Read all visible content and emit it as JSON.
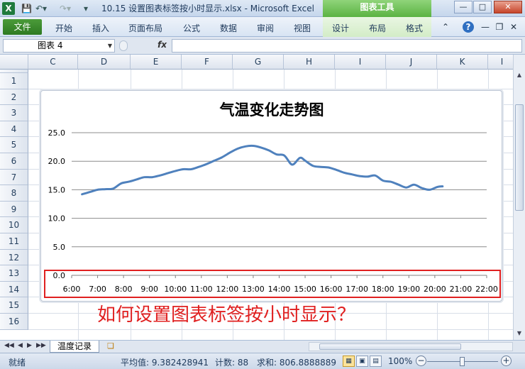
{
  "titlebar": {
    "app_icon": "X",
    "title": "10.15 设置图表标签按小时显示.xlsx  -  Microsoft Excel",
    "chart_tools": "图表工具",
    "icons": [
      "save-icon",
      "undo-icon",
      "redo-icon",
      "customize-icon"
    ]
  },
  "ribbon": {
    "file": "文件",
    "tabs": [
      "开始",
      "插入",
      "页面布局",
      "公式",
      "数据",
      "审阅",
      "视图"
    ],
    "context_tabs": [
      "设计",
      "布局",
      "格式"
    ]
  },
  "formula_bar": {
    "name_box": "图表 4",
    "fx": "fx",
    "value": ""
  },
  "grid": {
    "columns": [
      "C",
      "D",
      "E",
      "F",
      "G",
      "H",
      "I",
      "J",
      "K",
      "I"
    ],
    "rows": [
      "1",
      "2",
      "3",
      "4",
      "5",
      "6",
      "7",
      "8",
      "9",
      "10",
      "11",
      "12",
      "13",
      "14",
      "15",
      "16"
    ]
  },
  "chart_data": {
    "type": "line",
    "title": "气温变化走势图",
    "xlabel": "",
    "ylabel": "",
    "ylim": [
      0,
      25
    ],
    "yticks": [
      "0.0",
      "5.0",
      "10.0",
      "15.0",
      "20.0",
      "25.0"
    ],
    "xlim": [
      6,
      22
    ],
    "xticks": [
      "6:00",
      "7:00",
      "8:00",
      "9:00",
      "10:00",
      "11:00",
      "12:00",
      "13:00",
      "14:00",
      "15:00",
      "16:00",
      "17:00",
      "18:00",
      "19:00",
      "20:00",
      "21:00",
      "22:00"
    ],
    "grid": true,
    "legend": "none",
    "color": "#4f81bd",
    "x": [
      6.4,
      6.7,
      7.0,
      7.3,
      7.6,
      7.9,
      8.2,
      8.5,
      8.8,
      9.1,
      9.4,
      9.7,
      10.0,
      10.3,
      10.6,
      10.9,
      11.2,
      11.5,
      11.8,
      12.1,
      12.4,
      12.7,
      13.0,
      13.3,
      13.6,
      13.9,
      14.2,
      14.5,
      14.8,
      15.0,
      15.3,
      15.6,
      15.9,
      16.2,
      16.5,
      16.8,
      17.1,
      17.4,
      17.7,
      18.0,
      18.3,
      18.6,
      18.9,
      19.2,
      19.5,
      19.8,
      20.1,
      20.3
    ],
    "y": [
      14.2,
      14.6,
      15.0,
      15.1,
      15.2,
      16.1,
      16.4,
      16.8,
      17.2,
      17.2,
      17.5,
      17.9,
      18.3,
      18.6,
      18.6,
      19.0,
      19.5,
      20.1,
      20.7,
      21.5,
      22.2,
      22.6,
      22.7,
      22.4,
      21.9,
      21.2,
      21.0,
      19.4,
      20.6,
      20.1,
      19.2,
      19.0,
      18.9,
      18.5,
      18.0,
      17.7,
      17.4,
      17.3,
      17.5,
      16.6,
      16.4,
      15.9,
      15.4,
      15.9,
      15.3,
      15.0,
      15.5,
      15.6
    ]
  },
  "callout": {
    "question": "如何设置图表标签按小时显示？"
  },
  "sheetbar": {
    "sheet_tab": "温度记录"
  },
  "statusbar": {
    "ready": "就绪",
    "average": "平均值: 9.382428941",
    "count": "计数: 88",
    "sum": "求和: 806.8888889",
    "zoom": "100%"
  }
}
